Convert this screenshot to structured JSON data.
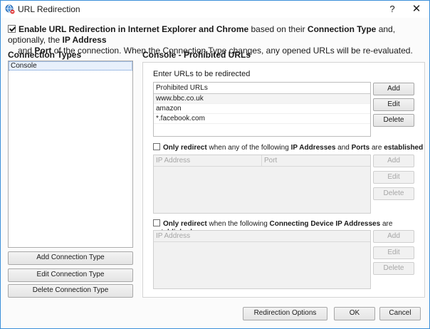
{
  "window": {
    "title": "URL Redirection",
    "help_label": "?",
    "close_label": "✕"
  },
  "enable": {
    "checked": true,
    "line1_prefix": "Enable URL Redirection in Internet Explorer and Chrome",
    "line1_mid": " based on their ",
    "line1_bold2": "Connection Type",
    "line1_mid2": " and, optionally, the ",
    "line1_bold3": "IP Address",
    "line2_bold": "Port",
    "line2_rest": " of the connection. When the Connection Type changes, any opened URLs will be re-evaluated.",
    "line2_and": "and "
  },
  "connection_types": {
    "title": "Connection Types",
    "items": [
      "Console"
    ],
    "add_label": "Add Connection Type",
    "edit_label": "Edit Connection Type",
    "delete_label": "Delete Connection Type"
  },
  "prohibited": {
    "section_title": "Console - Prohibited URLs",
    "instruction": "Enter URLs to be redirected",
    "column_header": "Prohibited URLs",
    "rows": [
      "www.bbc.co.uk",
      "amazon",
      "*.facebook.com"
    ],
    "add_label": "Add",
    "edit_label": "Edit",
    "delete_label": "Delete"
  },
  "ip_filter": {
    "checked": false,
    "t1": "Only redirect",
    "t2": " when any of the following ",
    "t3": "IP Addresses",
    "t4": " and ",
    "t5": "Ports",
    "t6": " are ",
    "t7": "established",
    "col1": "IP Address",
    "col2": "Port",
    "add_label": "Add",
    "edit_label": "Edit",
    "delete_label": "Delete"
  },
  "device_filter": {
    "checked": false,
    "t1": "Only redirect",
    "t2": " when the following ",
    "t3": "Connecting Device IP Addresses",
    "t4": " are ",
    "t5": "established",
    "col1": "IP Address",
    "add_label": "Add",
    "edit_label": "Edit",
    "delete_label": "Delete"
  },
  "footer": {
    "redirection_options_label": "Redirection Options",
    "ok_label": "OK",
    "cancel_label": "Cancel"
  },
  "colors": {
    "accent": "#3b8fd9",
    "selection": "#e8f0fb",
    "disabled_text": "#a6a6a6"
  }
}
